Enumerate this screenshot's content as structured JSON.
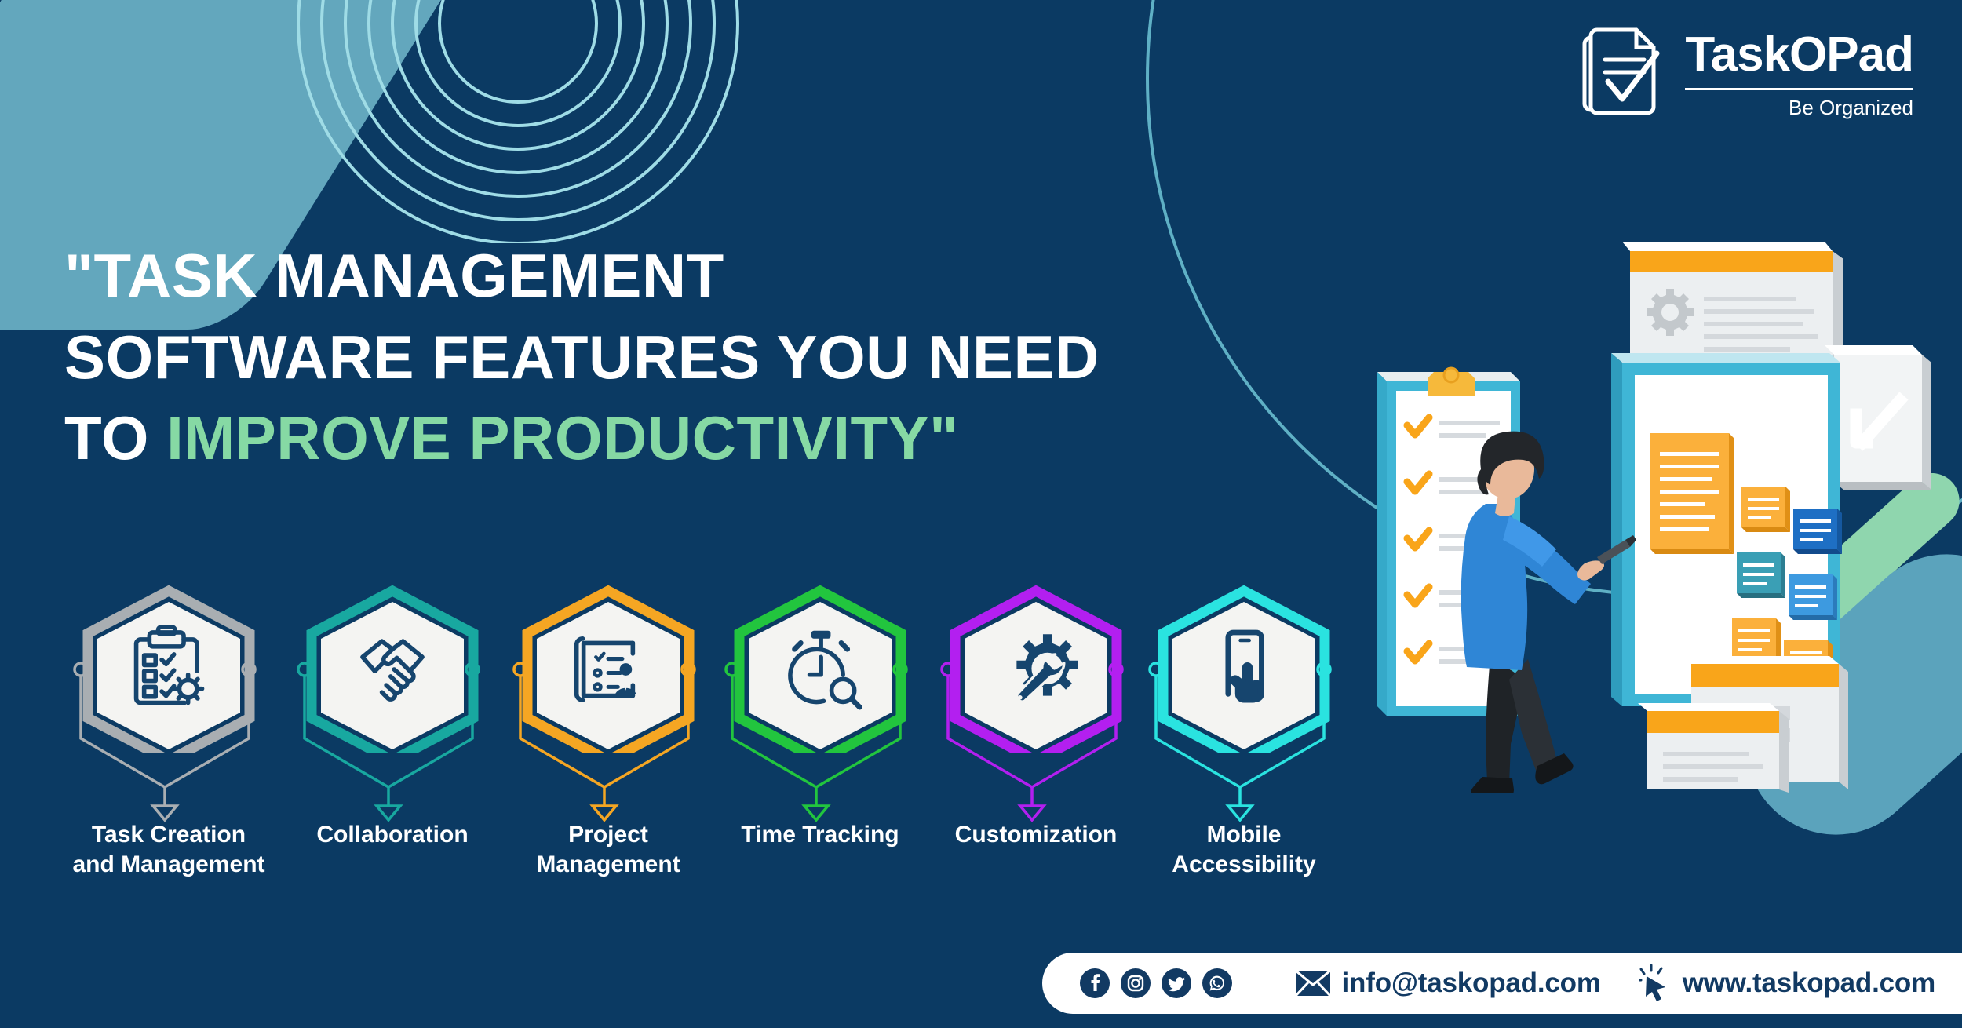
{
  "colors": {
    "background": "#0b3a63",
    "accent_green": "#86d9a4",
    "cyan_line": "#6ec6d6",
    "corner_wedge": "#63a7bd",
    "pill_mint": "#8fd6ae",
    "pill_slate": "#5ba3bc",
    "footer_text": "#123a63",
    "icon_navy": "#16456e"
  },
  "logo": {
    "brand": "TaskOPad",
    "tagline": "Be Organized",
    "mark_icon": "document-checkmark-icon"
  },
  "headline": {
    "line1": "\"TASK MANAGEMENT",
    "line2": "SOFTWARE FEATURES YOU NEED",
    "line3_prefix": "TO ",
    "line3_accent": "IMPROVE PRODUCTIVITY\""
  },
  "features": [
    {
      "label_line1": "Task Creation",
      "label_line2": "and Management",
      "color": "#a9aeb2",
      "icon": "clipboard-checklist-gear-icon"
    },
    {
      "label_line1": "Collaboration",
      "label_line2": "",
      "color": "#18a8a0",
      "icon": "handshake-icon"
    },
    {
      "label_line1": "Project",
      "label_line2": "Management",
      "color": "#f5a623",
      "icon": "project-list-person-icon"
    },
    {
      "label_line1": "Time Tracking",
      "label_line2": "",
      "color": "#22c53e",
      "icon": "stopwatch-search-icon"
    },
    {
      "label_line1": "Customization",
      "label_line2": "",
      "color": "#b31ff0",
      "icon": "gear-wrench-icon"
    },
    {
      "label_line1": "Mobile",
      "label_line2": "Accessibility",
      "color": "#2ae3e0",
      "icon": "phone-touch-icon"
    }
  ],
  "illustration": {
    "name": "isometric-task-management-scene",
    "description": "Man pointing at kanban board with clipboard, gear panel and checkmark card"
  },
  "footer": {
    "social": [
      {
        "name": "facebook-icon",
        "label": "Facebook"
      },
      {
        "name": "instagram-icon",
        "label": "Instagram"
      },
      {
        "name": "twitter-icon",
        "label": "Twitter"
      },
      {
        "name": "whatsapp-icon",
        "label": "WhatsApp"
      }
    ],
    "email_icon": "envelope-icon",
    "email": "info@taskopad.com",
    "website_icon": "cursor-click-icon",
    "website": "www.taskopad.com"
  }
}
